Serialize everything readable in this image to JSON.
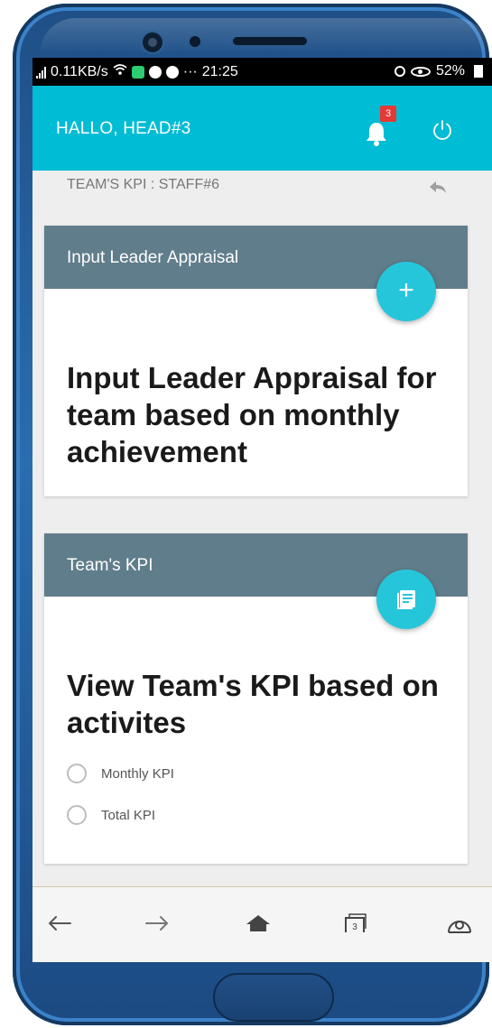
{
  "status_bar": {
    "network": "0.11KB/s",
    "time": "21:25",
    "dots": "···",
    "battery": "52%"
  },
  "app_bar": {
    "greeting": "HALLO, HEAD#3",
    "notification_count": "3"
  },
  "subheader": {
    "title": "TEAM'S KPI : STAFF#6"
  },
  "cards": [
    {
      "header": "Input Leader Appraisal",
      "fab_icon": "plus-icon",
      "body": "Input Leader Appraisal for team based on monthly achievement"
    },
    {
      "header": "Team's KPI",
      "fab_icon": "list-icon",
      "body": "View Team's KPI based on activites",
      "options": [
        "Monthly KPI",
        "Total KPI"
      ]
    }
  ],
  "bottom_nav": {
    "items": [
      "back-icon",
      "forward-icon",
      "home-icon",
      "tabs-icon",
      "menu-icon"
    ],
    "tab_count": "3"
  },
  "colors": {
    "app_bar": "#00bcd4",
    "card_header": "#607d8b",
    "fab": "#26c6da",
    "badge": "#e53935",
    "phone_body": "#2a6db0"
  }
}
